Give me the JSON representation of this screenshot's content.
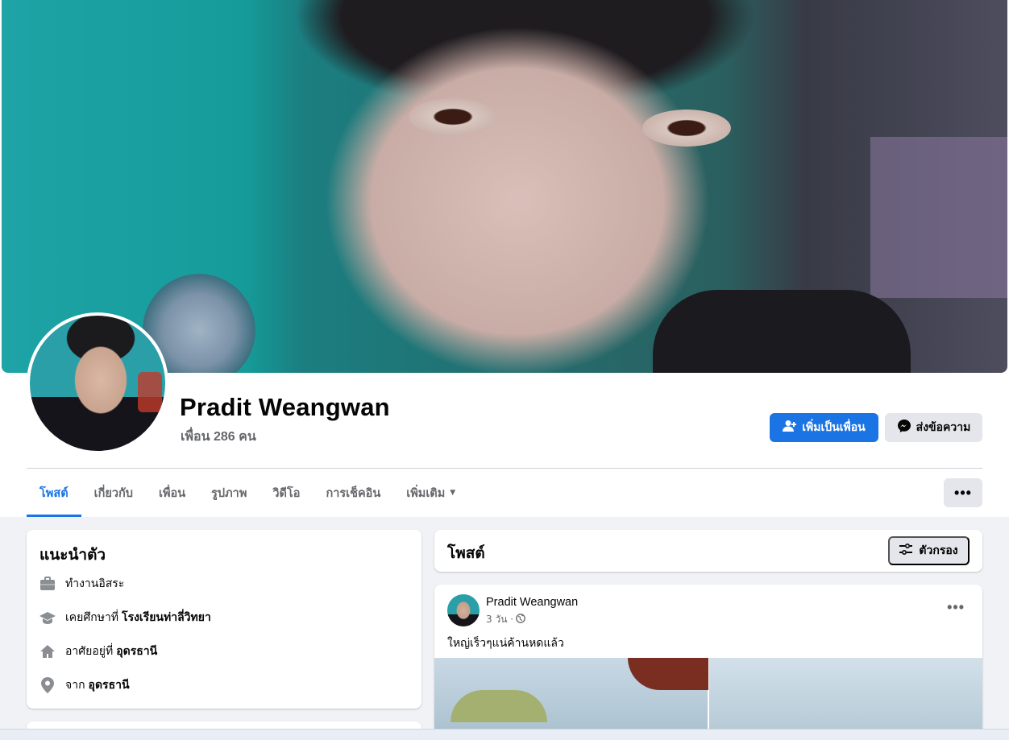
{
  "profile": {
    "name": "Pradit Weangwan",
    "friends": "เพื่อน 286 คน"
  },
  "actions": {
    "add_friend": "เพิ่มเป็นเพื่อน",
    "message": "ส่งข้อความ",
    "more": "•••"
  },
  "tabs": [
    {
      "label": "โพสต์",
      "active": true
    },
    {
      "label": "เกี่ยวกับ"
    },
    {
      "label": "เพื่อน"
    },
    {
      "label": "รูปภาพ"
    },
    {
      "label": "วิดีโอ"
    },
    {
      "label": "การเช็คอิน"
    },
    {
      "label": "เพิ่มเติม"
    }
  ],
  "intro": {
    "title": "แนะนำตัว",
    "items": [
      {
        "icon": "briefcase-icon",
        "text": "ทำงานอิสระ",
        "bold": ""
      },
      {
        "icon": "graduation-cap-icon",
        "text": "เคยศึกษาที่",
        "bold": "โรงเรียนท่าลี่วิทยา"
      },
      {
        "icon": "home-icon",
        "text": "อาศัยอยู่ที่",
        "bold": "อุดรธานี"
      },
      {
        "icon": "location-pin-icon",
        "text": "จาก",
        "bold": "อุดรธานี"
      }
    ]
  },
  "posts": {
    "title": "โพสต์",
    "filter_label": "ตัวกรอง"
  },
  "post": {
    "author": "Pradit Weangwan",
    "time": "3 วัน ·",
    "text": "ใหญ่เร็วๆแน่ค้านหดแล้ว",
    "options": "•••"
  },
  "colors": {
    "accent": "#1b74e4",
    "secondary_button": "#e4e6eb",
    "page_background": "#f0f2f5",
    "muted_text": "#65676b"
  }
}
